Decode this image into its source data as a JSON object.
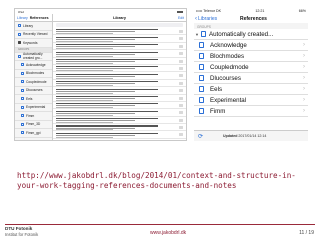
{
  "ipad": {
    "nav": {
      "back": "Library",
      "left_title": "References",
      "center_title": "Library",
      "edit": "Edit"
    },
    "sidebar": {
      "items": [
        {
          "label": "Library",
          "level": 0
        },
        {
          "label": "Recently Viewed",
          "level": 0
        },
        {
          "label": "Keywords",
          "level": 0
        },
        {
          "label": "GROUPS",
          "level": 0
        },
        {
          "label": "Automatically created gro...",
          "level": 0
        },
        {
          "label": "Acknowledge",
          "level": 1
        },
        {
          "label": "Blochmodes",
          "level": 1
        },
        {
          "label": "Coupledmode",
          "level": 1
        },
        {
          "label": "Dlucourses",
          "level": 1
        },
        {
          "label": "Eels",
          "level": 1
        },
        {
          "label": "Experimental",
          "level": 1
        },
        {
          "label": "Fimm",
          "level": 1
        },
        {
          "label": "Fimm_3D",
          "level": 1
        },
        {
          "label": "Fimm_gpi",
          "level": 1
        }
      ]
    },
    "list_count": 15
  },
  "iphone": {
    "status": {
      "carrier": "••••• Telenor DK",
      "time": "12:21",
      "battery": "66%"
    },
    "nav": {
      "back": "Libraries",
      "title": "References"
    },
    "groups_header": "GROUPS",
    "parent": "Automatically created...",
    "children": [
      "Acknowledge",
      "Blochmodes",
      "Coupledmode",
      "Dlucourses",
      "Eels",
      "Experimental",
      "Fimm"
    ],
    "footer": {
      "prefix": "Updated",
      "date": "2017/01/14 12:14"
    }
  },
  "link_text": "http://www.jakobdrl.dk/blog/2014/01/context-and-structure-in-your-work-tagging-references-documents-and-notes",
  "footer": {
    "org_line1": "DTU Fotonik",
    "org_line2": "Institut for Fotonik",
    "website": "www.jakobdrl.dk",
    "page": "11 / 19"
  }
}
